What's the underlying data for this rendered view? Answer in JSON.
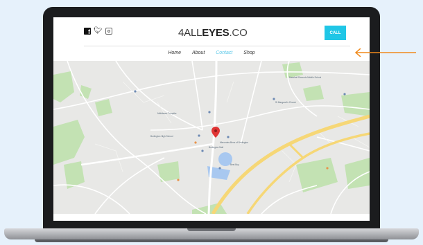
{
  "site": {
    "logo_part1": "4ALL",
    "logo_part2": "EYES",
    "logo_part3": ".CO",
    "call_label": "CALL",
    "social_icons": [
      "facebook-icon",
      "twitter-icon",
      "instagram-icon"
    ]
  },
  "nav": {
    "items": [
      {
        "label": "Home",
        "active": false
      },
      {
        "label": "About",
        "active": false
      },
      {
        "label": "Contact",
        "active": true
      },
      {
        "label": "Shop",
        "active": false
      }
    ]
  },
  "colors": {
    "page_background": "#e6f1fb",
    "accent": "#20c6e6",
    "active_nav": "#5bc8e8",
    "arrow": "#f08a1c",
    "map_pin": "#e03434"
  },
  "map": {
    "places": [
      "Burlington High School",
      "Burlington Mall",
      "Middlesex Turnpike",
      "St Margaret's Church",
      "Marshall Simonds Middle School",
      "Mercedes-Benz of Burlington",
      "Best Buy"
    ]
  }
}
